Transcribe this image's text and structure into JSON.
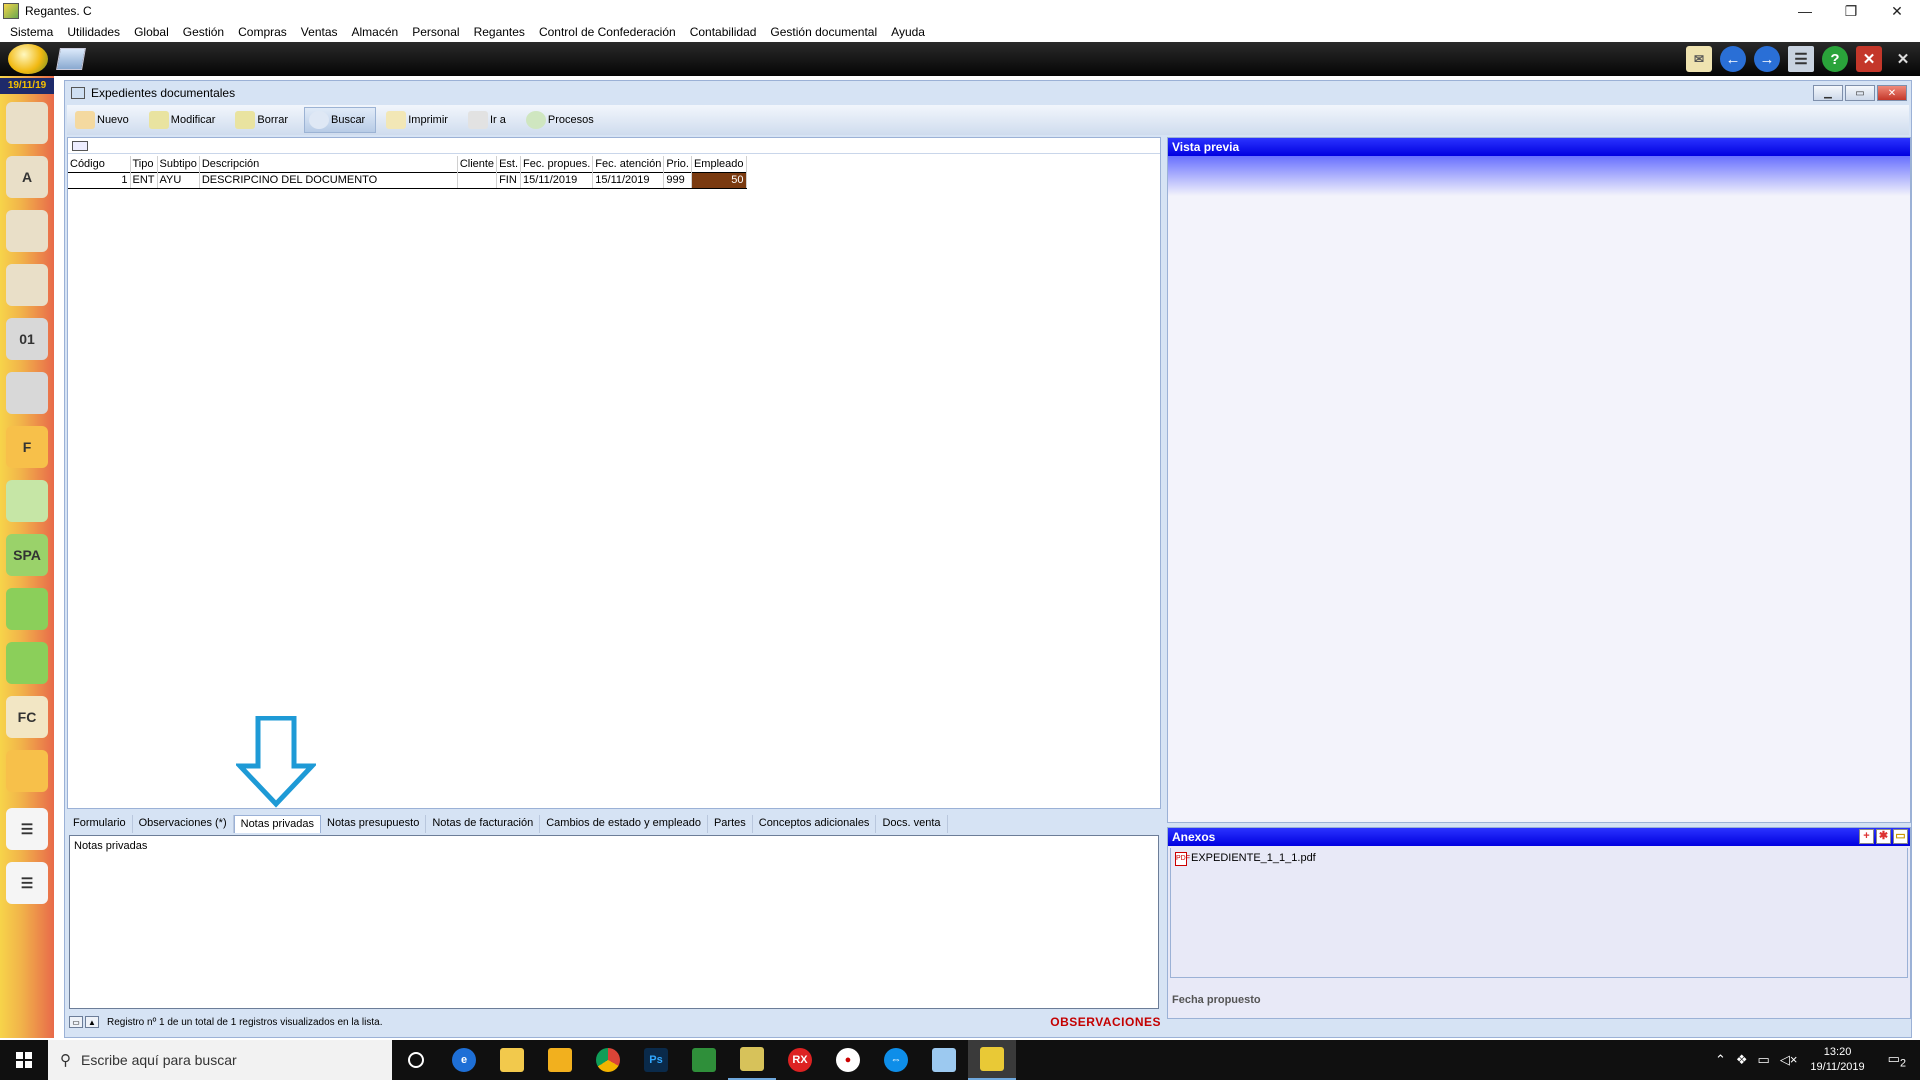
{
  "window": {
    "title": "Regantes. C",
    "minimize": "—",
    "restore": "❐",
    "close": "✕"
  },
  "menu": [
    "Sistema",
    "Utilidades",
    "Global",
    "Gestión",
    "Compras",
    "Ventas",
    "Almacén",
    "Personal",
    "Regantes",
    "Control de Confederación",
    "Contabilidad",
    "Gestión documental",
    "Ayuda"
  ],
  "sidebar": {
    "date": "19/11/19"
  },
  "doc": {
    "title": "Expedientes documentales",
    "toolbar": {
      "nuevo": "Nuevo",
      "modificar": "Modificar",
      "borrar": "Borrar",
      "buscar": "Buscar",
      "imprimir": "Imprimir",
      "ir_a": "Ir a",
      "procesos": "Procesos"
    },
    "table": {
      "headers": [
        "Código",
        "Tipo",
        "Subtipo",
        "Descripción",
        "Cliente",
        "Est.",
        "Fec. propues.",
        "Fec. atención",
        "Prio.",
        "Empleado"
      ],
      "rows": [
        [
          "1",
          "ENT",
          "AYU",
          "DESCRIPCINO DEL DOCUMENTO",
          "",
          "FIN",
          "15/11/2019",
          "15/11/2019",
          "999",
          "50"
        ]
      ]
    },
    "tabs": [
      "Formulario",
      "Observaciones (*)",
      "Notas privadas",
      "Notas presupuesto",
      "Notas de facturación",
      "Cambios de estado y empleado",
      "Partes",
      "Conceptos adicionales",
      "Docs. venta"
    ],
    "notes_text": "Notas privadas",
    "status_text": "Registro nº 1 de un total de 1 registros visualizados en la lista.",
    "status_flag": "OBSERVACIONES"
  },
  "preview": {
    "title": "Vista previa"
  },
  "anexos": {
    "title": "Anexos",
    "files": [
      "EXPEDIENTE_1_1_1.pdf"
    ],
    "footer": "Fecha propuesto"
  },
  "taskbar": {
    "search_placeholder": "Escribe aquí para buscar",
    "time": "13:20",
    "date": "19/11/2019",
    "notifications": "2"
  },
  "colors": {
    "accent_blue": "#0000e0",
    "status_red": "#c40000",
    "sidebar_gradient_top": "#f7d44a"
  }
}
